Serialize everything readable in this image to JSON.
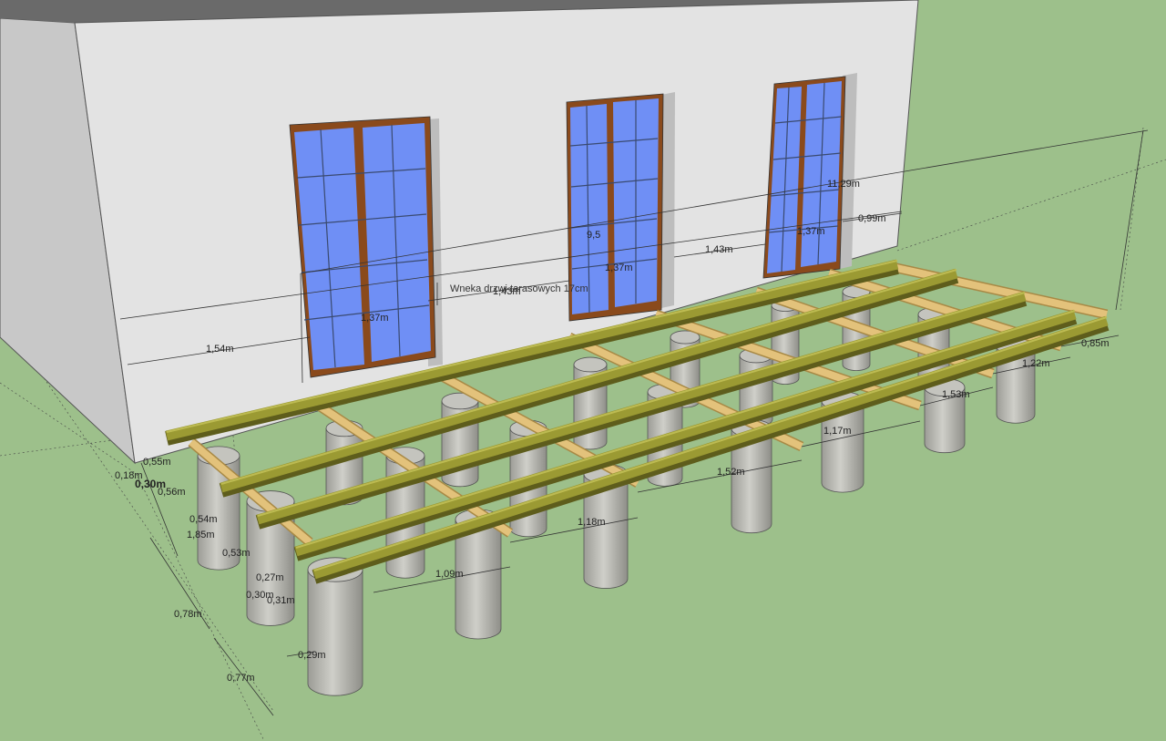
{
  "annotation": {
    "note": "Wneka drzwi tarasowych 17cm"
  },
  "dimensions": {
    "facade_left": "1,54m",
    "window1_width": "1,37m",
    "between_w1_w2": "1,43m",
    "window2_width": "1,37m",
    "between_w2_w3": "1,43m",
    "window3_width": "1,37m",
    "facade_right": "0,99m",
    "total_recess": "9,5",
    "total_length": "11,29m",
    "offset_a": "0,55m",
    "offset_b": "0,18m",
    "offset_c": "0,30m",
    "offset_d": "0,56m",
    "row_gap_a": "0,54m",
    "row_gap_b": "1,85m",
    "row_gap_c": "0,53m",
    "pillar_a": "0,27m",
    "pillar_b": "0,30m",
    "pillar_c": "0,31m",
    "pillar_d": "0,29m",
    "vertical_a": "0,78m",
    "vertical_b": "0,77m",
    "span_1": "1,09m",
    "span_2": "1,18m",
    "span_3": "1,52m",
    "span_4": "1,17m",
    "span_5": "1,53m",
    "span_6": "1,22m",
    "overhang": "0,85m"
  },
  "colors": {
    "grass": "#9dc08b",
    "wall_front": "#e2e2e2",
    "wall_side": "#c8c8c8",
    "glass": "#6f8ff5",
    "frame": "#8a4a1c",
    "beam": "#9b9a33",
    "joist": "#e3c27b",
    "pillar": "#b6b6b0"
  }
}
